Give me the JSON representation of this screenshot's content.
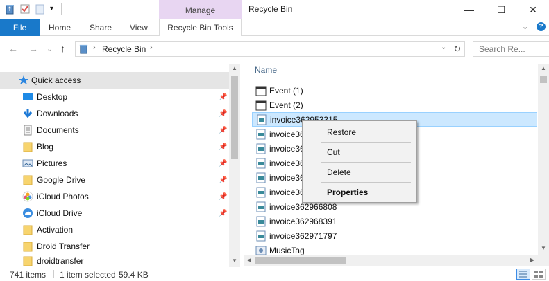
{
  "window": {
    "title": "Recycle Bin",
    "context_tab": "Manage",
    "controls": {
      "minimize": "—",
      "maximize": "☐",
      "close": "✕"
    }
  },
  "ribbon": {
    "file": "File",
    "tabs": [
      "Home",
      "Share",
      "View"
    ],
    "context_tab_label": "Recycle Bin Tools",
    "collapse_icon": "⌄",
    "help_icon": "?"
  },
  "address_bar": {
    "back": "←",
    "forward": "→",
    "recent": "⌄",
    "up": "↑",
    "separator": "›",
    "location": "Recycle Bin",
    "trail_separator": "›",
    "dropdown": "⌄",
    "refresh": "↻",
    "search_placeholder": "Search Re..."
  },
  "nav_pane": {
    "quick_access": "Quick access",
    "items": [
      {
        "label": "Desktop",
        "icon": "desktop-icon",
        "pinned": true
      },
      {
        "label": "Downloads",
        "icon": "downloads-icon",
        "pinned": true
      },
      {
        "label": "Documents",
        "icon": "documents-icon",
        "pinned": true
      },
      {
        "label": "Blog",
        "icon": "folder-icon",
        "pinned": true
      },
      {
        "label": "Pictures",
        "icon": "pictures-icon",
        "pinned": true
      },
      {
        "label": "Google Drive",
        "icon": "folder-icon",
        "pinned": true
      },
      {
        "label": "iCloud Photos",
        "icon": "icloud-photos-icon",
        "pinned": true
      },
      {
        "label": "iCloud Drive",
        "icon": "icloud-drive-icon",
        "pinned": true
      },
      {
        "label": "Activation",
        "icon": "folder-icon",
        "pinned": false
      },
      {
        "label": "Droid Transfer",
        "icon": "folder-icon",
        "pinned": false
      },
      {
        "label": "droidtransfer",
        "icon": "folder-icon",
        "pinned": false
      }
    ],
    "pin_glyph": "📌"
  },
  "file_list": {
    "column_name": "Name",
    "files": [
      {
        "name": "Event (1)",
        "icon": "calendar-icon"
      },
      {
        "name": "Event (2)",
        "icon": "calendar-icon"
      },
      {
        "name": "invoice362953315",
        "icon": "image-file-icon",
        "selected": true
      },
      {
        "name": "invoice36",
        "icon": "image-file-icon"
      },
      {
        "name": "invoice36",
        "icon": "image-file-icon"
      },
      {
        "name": "invoice36",
        "icon": "image-file-icon"
      },
      {
        "name": "invoice36",
        "icon": "image-file-icon"
      },
      {
        "name": "invoice36",
        "icon": "image-file-icon"
      },
      {
        "name": "invoice362966808",
        "icon": "image-file-icon"
      },
      {
        "name": "invoice362968391",
        "icon": "image-file-icon"
      },
      {
        "name": "invoice362971797",
        "icon": "image-file-icon"
      },
      {
        "name": "MusicTag",
        "icon": "app-icon"
      }
    ]
  },
  "context_menu": {
    "restore": "Restore",
    "cut": "Cut",
    "delete": "Delete",
    "properties": "Properties"
  },
  "status_bar": {
    "item_count": "741 items",
    "selection": "1 item selected",
    "size": "59.4 KB"
  },
  "colors": {
    "file_tab": "#1979ca",
    "manage_tab": "#e8d6f2",
    "selection": "#cce8ff",
    "quick_access_bg": "#e5e5e5"
  }
}
